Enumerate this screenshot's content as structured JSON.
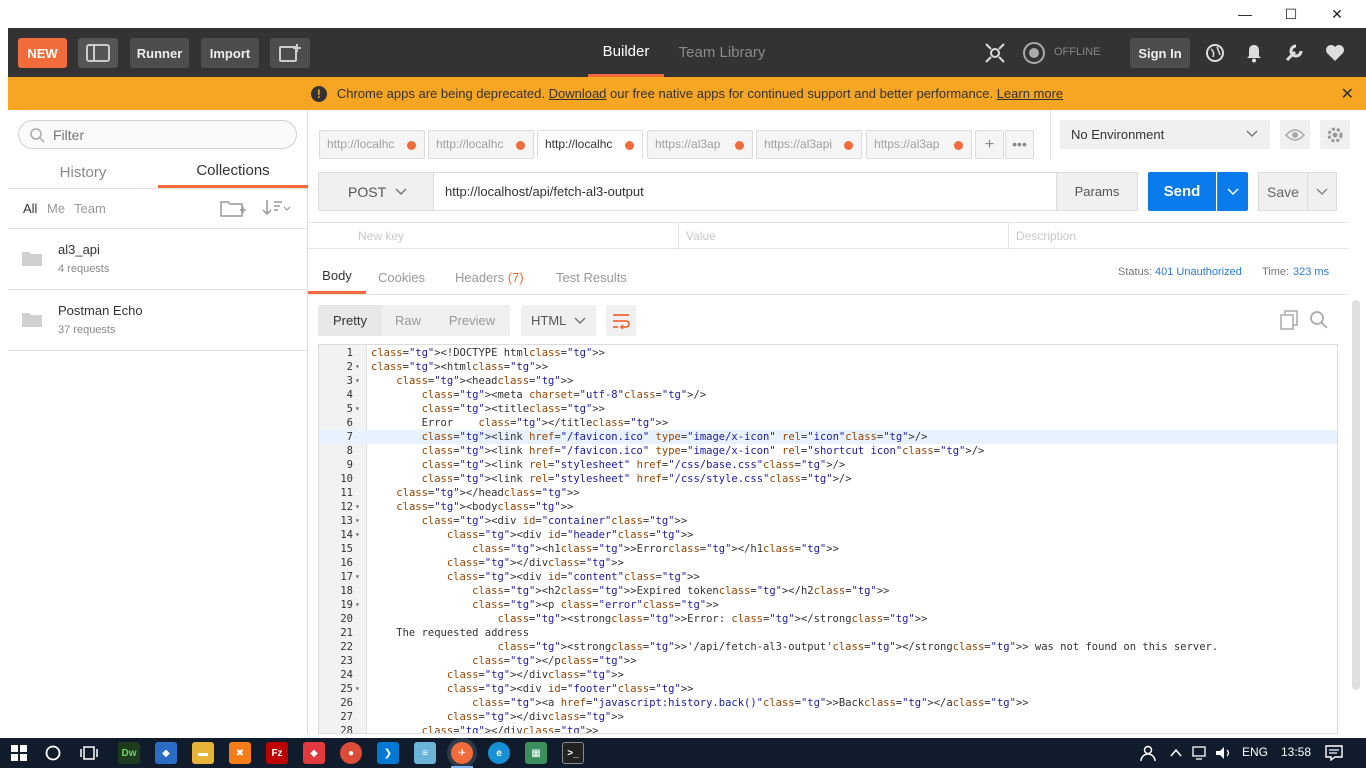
{
  "window": {
    "minimize": "—",
    "maximize": "☐",
    "close": "✕"
  },
  "header": {
    "new_label": "NEW",
    "runner_label": "Runner",
    "import_label": "Import",
    "builder_tab": "Builder",
    "team_library_tab": "Team Library",
    "offline_label": "OFFLINE",
    "signin_label": "Sign In"
  },
  "banner": {
    "text_before": "Chrome apps are being deprecated.",
    "link_download": "Download",
    "text_after": "our free native apps for continued support and better performance.",
    "link_learn": "Learn more"
  },
  "sidebar": {
    "filter_placeholder": "Filter",
    "tab_history": "History",
    "tab_collections": "Collections",
    "filter_all": "All",
    "filter_me": "Me",
    "filter_team": "Team",
    "collections": [
      {
        "name": "al3_api",
        "count": "4 requests"
      },
      {
        "name": "Postman Echo",
        "count": "37 requests"
      }
    ]
  },
  "tabs": [
    {
      "label": "http://localhc"
    },
    {
      "label": "http://localhc"
    },
    {
      "label": "http://localhc"
    },
    {
      "label": "https://al3ap"
    },
    {
      "label": "https://al3api"
    },
    {
      "label": "https://al3ap"
    }
  ],
  "environment": {
    "selected": "No Environment"
  },
  "request": {
    "method": "POST",
    "url": "http://localhost/api/fetch-al3-output",
    "params_label": "Params",
    "send_label": "Send",
    "save_label": "Save"
  },
  "params_row": {
    "key_placeholder": "New key",
    "value_placeholder": "Value",
    "description_placeholder": "Description"
  },
  "response": {
    "tab_body": "Body",
    "tab_cookies": "Cookies",
    "tab_headers": "Headers",
    "headers_count": "(7)",
    "tab_tests": "Test Results",
    "status_label": "Status:",
    "status_value": "401 Unauthorized",
    "time_label": "Time:",
    "time_value": "323 ms",
    "view_pretty": "Pretty",
    "view_raw": "Raw",
    "view_preview": "Preview",
    "format": "HTML"
  },
  "code_lines": [
    {
      "n": "1",
      "fold": "",
      "text": "<!DOCTYPE html>"
    },
    {
      "n": "2",
      "fold": "▾",
      "text": "<html>"
    },
    {
      "n": "3",
      "fold": "▾",
      "text": "    <head>"
    },
    {
      "n": "4",
      "fold": "",
      "text": "        <meta charset=\"utf-8\"/>"
    },
    {
      "n": "5",
      "fold": "▾",
      "text": "        <title>"
    },
    {
      "n": "6",
      "fold": "",
      "text": "        Error    </title>"
    },
    {
      "n": "7",
      "fold": "",
      "text": "        <link href=\"/favicon.ico\" type=\"image/x-icon\" rel=\"icon\"/>"
    },
    {
      "n": "8",
      "fold": "",
      "text": "        <link href=\"/favicon.ico\" type=\"image/x-icon\" rel=\"shortcut icon\"/>"
    },
    {
      "n": "9",
      "fold": "",
      "text": "        <link rel=\"stylesheet\" href=\"/css/base.css\"/>"
    },
    {
      "n": "10",
      "fold": "",
      "text": "        <link rel=\"stylesheet\" href=\"/css/style.css\"/>"
    },
    {
      "n": "11",
      "fold": "",
      "text": "    </head>"
    },
    {
      "n": "12",
      "fold": "▾",
      "text": "    <body>"
    },
    {
      "n": "13",
      "fold": "▾",
      "text": "        <div id=\"container\">"
    },
    {
      "n": "14",
      "fold": "▾",
      "text": "            <div id=\"header\">"
    },
    {
      "n": "15",
      "fold": "",
      "text": "                <h1>Error</h1>"
    },
    {
      "n": "16",
      "fold": "",
      "text": "            </div>"
    },
    {
      "n": "17",
      "fold": "▾",
      "text": "            <div id=\"content\">"
    },
    {
      "n": "18",
      "fold": "",
      "text": "                <h2>Expired token</h2>"
    },
    {
      "n": "19",
      "fold": "▾",
      "text": "                <p class=\"error\">"
    },
    {
      "n": "20",
      "fold": "",
      "text": "                    <strong>Error: </strong>"
    },
    {
      "n": "21",
      "fold": "",
      "text": "    The requested address"
    },
    {
      "n": "22",
      "fold": "",
      "text": "                    <strong>'/api/fetch-al3-output'</strong> was not found on this server."
    },
    {
      "n": "23",
      "fold": "",
      "text": "                </p>"
    },
    {
      "n": "24",
      "fold": "",
      "text": "            </div>"
    },
    {
      "n": "25",
      "fold": "▾",
      "text": "            <div id=\"footer\">"
    },
    {
      "n": "26",
      "fold": "",
      "text": "                <a href=\"javascript:history.back()\">Back</a>"
    },
    {
      "n": "27",
      "fold": "",
      "text": "            </div>"
    },
    {
      "n": "28",
      "fold": "",
      "text": "        </div>"
    }
  ],
  "taskbar": {
    "language": "ENG",
    "time": "13:58"
  },
  "colors": {
    "accent": "#f26b3a",
    "send_blue": "#097bed",
    "banner": "#f6a623",
    "header": "#333333"
  }
}
